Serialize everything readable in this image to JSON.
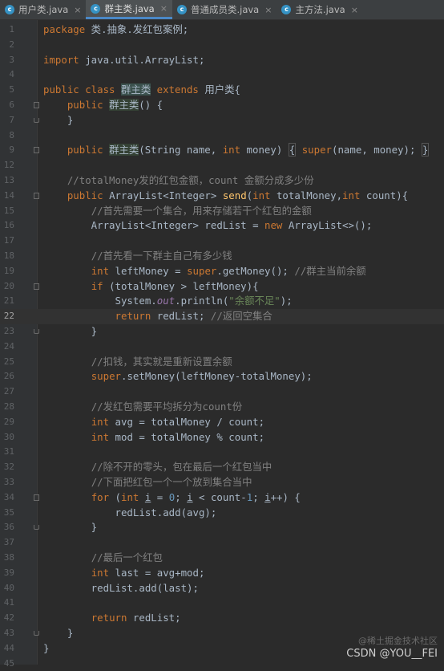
{
  "tabs": [
    {
      "label": "用户类.java",
      "active": false
    },
    {
      "label": "群主类.java",
      "active": true
    },
    {
      "label": "普通成员类.java",
      "active": false
    },
    {
      "label": "主方法.java",
      "active": false
    }
  ],
  "tab_icon_letter": "c",
  "tab_close_glyph": "×",
  "current_line": 22,
  "lines": [
    {
      "n": 1,
      "fold": "",
      "html": "<span class=\"kw\">package</span> 类.抽象.发红包案例;"
    },
    {
      "n": 2,
      "fold": "",
      "html": ""
    },
    {
      "n": 3,
      "fold": "",
      "html": "<span class=\"kw\">import</span> java.util.ArrayList;"
    },
    {
      "n": 4,
      "fold": "",
      "html": ""
    },
    {
      "n": 5,
      "fold": "",
      "html": "<span class=\"kw\">public class</span> <span class=\"hl2\">群主类</span> <span class=\"kw\">extends</span> 用户类{"
    },
    {
      "n": 6,
      "fold": "start",
      "html": "    <span class=\"kw\">public</span> <span class=\"hl\">群主类</span>() {"
    },
    {
      "n": 7,
      "fold": "end",
      "html": "    }"
    },
    {
      "n": 8,
      "fold": "",
      "html": ""
    },
    {
      "n": 9,
      "fold": "start",
      "html": "    <span class=\"kw\">public</span> <span class=\"hl\">群主类</span>(String name, <span class=\"kw\">int</span> money) <span class=\"fb\">{</span> <span class=\"kw\">super</span>(name, money); <span class=\"fb\">}</span>"
    },
    {
      "n": 12,
      "fold": "",
      "html": ""
    },
    {
      "n": 13,
      "fold": "",
      "html": "    <span class=\"cm\">//totalMoney发的红包金额，count 金额分成多少份</span>"
    },
    {
      "n": 14,
      "fold": "start",
      "html": "    <span class=\"kw\">public</span> ArrayList&lt;Integer&gt; <span class=\"fn\">send</span>(<span class=\"kw\">int</span> totalMoney,<span class=\"kw\">int</span> count){"
    },
    {
      "n": 15,
      "fold": "",
      "html": "        <span class=\"cm\">//首先需要一个集合，用来存储若干个红包的金额</span>"
    },
    {
      "n": 16,
      "fold": "",
      "html": "        ArrayList&lt;Integer&gt; redList = <span class=\"kw\">new</span> ArrayList&lt;&gt;();"
    },
    {
      "n": 17,
      "fold": "",
      "html": ""
    },
    {
      "n": 18,
      "fold": "",
      "html": "        <span class=\"cm\">//首先看一下群主自己有多少钱</span>"
    },
    {
      "n": 19,
      "fold": "",
      "html": "        <span class=\"kw\">int</span> leftMoney = <span class=\"kw\">super</span>.getMoney(); <span class=\"cm\">//群主当前余额</span>"
    },
    {
      "n": 20,
      "fold": "start",
      "html": "        <span class=\"kw\">if</span> (totalMoney &gt; leftMoney){"
    },
    {
      "n": 21,
      "fold": "",
      "html": "            System.<span class=\"it\">out</span>.println(<span class=\"str\">\"余额不足\"</span>);"
    },
    {
      "n": 22,
      "fold": "",
      "html": "            <span class=\"kw\">return</span> redList; <span class=\"cm\">//返回空集合</span>"
    },
    {
      "n": 23,
      "fold": "end",
      "html": "        }"
    },
    {
      "n": 24,
      "fold": "",
      "html": ""
    },
    {
      "n": 25,
      "fold": "",
      "html": "        <span class=\"cm\">//扣钱，其实就是重新设置余额</span>"
    },
    {
      "n": 26,
      "fold": "",
      "html": "        <span class=\"kw\">super</span>.setMoney(leftMoney-totalMoney);"
    },
    {
      "n": 27,
      "fold": "",
      "html": ""
    },
    {
      "n": 28,
      "fold": "",
      "html": "        <span class=\"cm\">//发红包需要平均拆分为count份</span>"
    },
    {
      "n": 29,
      "fold": "",
      "html": "        <span class=\"kw\">int</span> avg = totalMoney / count;"
    },
    {
      "n": 30,
      "fold": "",
      "html": "        <span class=\"kw\">int</span> mod = totalMoney % count;"
    },
    {
      "n": 31,
      "fold": "",
      "html": ""
    },
    {
      "n": 32,
      "fold": "",
      "html": "        <span class=\"cm\">//除不开的零头，包在最后一个红包当中</span>"
    },
    {
      "n": 33,
      "fold": "",
      "html": "        <span class=\"cm\">//下面把红包一个一个放到集合当中</span>"
    },
    {
      "n": 34,
      "fold": "start",
      "html": "        <span class=\"kw\">for</span> (<span class=\"kw\">int</span> <span class=\"ul\">i</span> = <span class=\"num\">0</span>; <span class=\"ul\">i</span> &lt; count-<span class=\"num\">1</span>; <span class=\"ul\">i</span>++) {"
    },
    {
      "n": 35,
      "fold": "",
      "html": "            redList.add(avg);"
    },
    {
      "n": 36,
      "fold": "end",
      "html": "        }"
    },
    {
      "n": 37,
      "fold": "",
      "html": ""
    },
    {
      "n": 38,
      "fold": "",
      "html": "        <span class=\"cm\">//最后一个红包</span>"
    },
    {
      "n": 39,
      "fold": "",
      "html": "        <span class=\"kw\">int</span> last = avg+mod;"
    },
    {
      "n": 40,
      "fold": "",
      "html": "        redList.add(last);"
    },
    {
      "n": 41,
      "fold": "",
      "html": ""
    },
    {
      "n": 42,
      "fold": "",
      "html": "        <span class=\"kw\">return</span> redList;"
    },
    {
      "n": 43,
      "fold": "end",
      "html": "    }"
    },
    {
      "n": 44,
      "fold": "",
      "html": "}"
    },
    {
      "n": 45,
      "fold": "",
      "html": ""
    }
  ],
  "watermark": {
    "line1": "@稀土掘金技术社区",
    "line2": "CSDN @YOU__FEI"
  }
}
